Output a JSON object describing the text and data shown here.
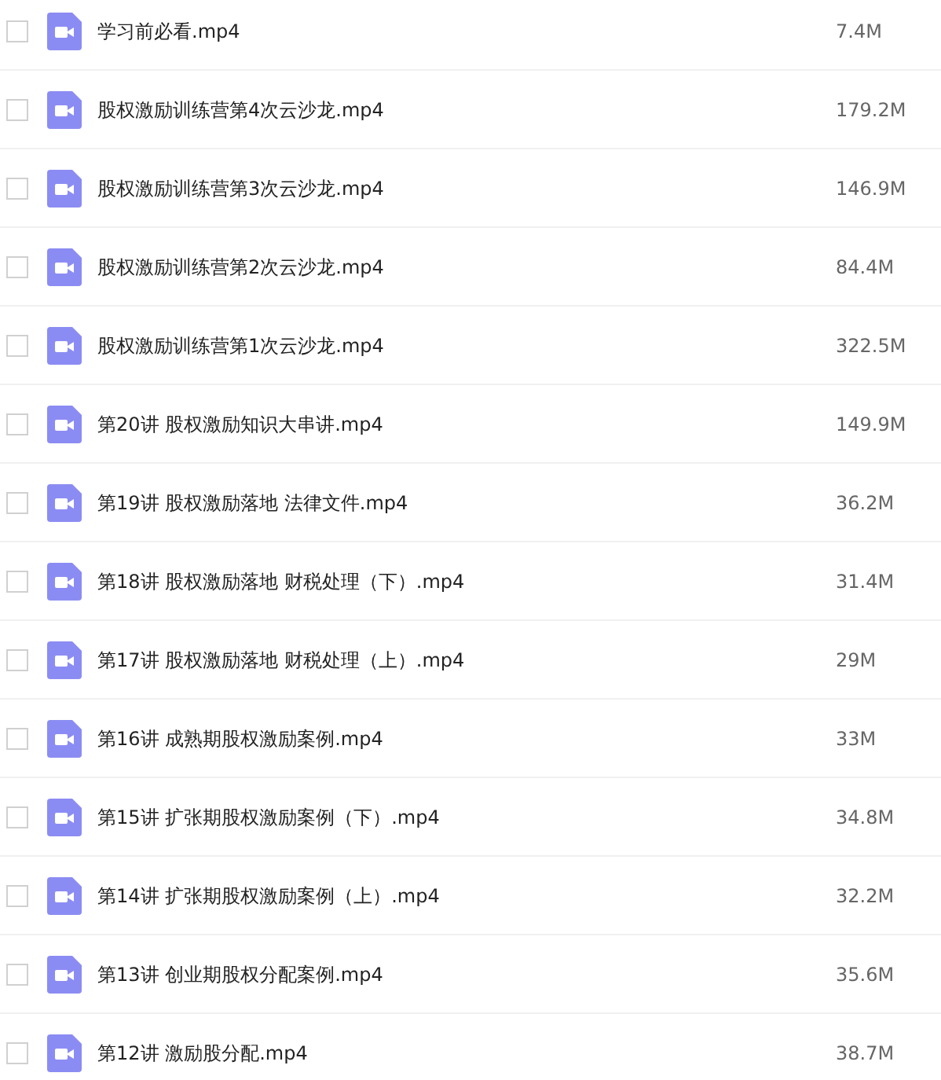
{
  "files": [
    {
      "name": "学习前必看.mp4",
      "size": "7.4M",
      "checked": false
    },
    {
      "name": "股权激励训练营第4次云沙龙.mp4",
      "size": "179.2M",
      "checked": false
    },
    {
      "name": "股权激励训练营第3次云沙龙.mp4",
      "size": "146.9M",
      "checked": false
    },
    {
      "name": "股权激励训练营第2次云沙龙.mp4",
      "size": "84.4M",
      "checked": false
    },
    {
      "name": "股权激励训练营第1次云沙龙.mp4",
      "size": "322.5M",
      "checked": false
    },
    {
      "name": "第20讲 股权激励知识大串讲.mp4",
      "size": "149.9M",
      "checked": false
    },
    {
      "name": "第19讲 股权激励落地 法律文件.mp4",
      "size": "36.2M",
      "checked": false
    },
    {
      "name": "第18讲 股权激励落地 财税处理（下）.mp4",
      "size": "31.4M",
      "checked": false
    },
    {
      "name": "第17讲 股权激励落地 财税处理（上）.mp4",
      "size": "29M",
      "checked": false
    },
    {
      "name": "第16讲 成熟期股权激励案例.mp4",
      "size": "33M",
      "checked": false
    },
    {
      "name": "第15讲 扩张期股权激励案例（下）.mp4",
      "size": "34.8M",
      "checked": false
    },
    {
      "name": "第14讲 扩张期股权激励案例（上）.mp4",
      "size": "32.2M",
      "checked": false
    },
    {
      "name": "第13讲 创业期股权分配案例.mp4",
      "size": "35.6M",
      "checked": false
    },
    {
      "name": "第12讲 激励股分配.mp4",
      "size": "38.7M",
      "checked": false
    }
  ]
}
